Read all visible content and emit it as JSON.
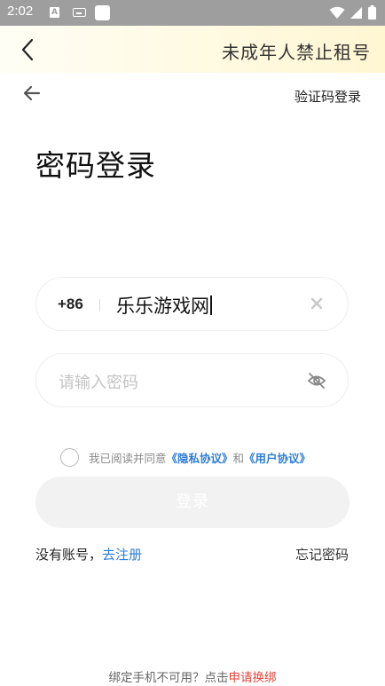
{
  "status_bar": {
    "time": "2:02",
    "notification_icons": [
      "a-icon",
      "keyboard-icon",
      "square-icon"
    ],
    "system_icons": [
      "wifi-icon",
      "signal-icon",
      "battery-icon"
    ]
  },
  "top_bar": {
    "title": "未成年人禁止租号"
  },
  "nav": {
    "switch_login_label": "验证码登录"
  },
  "page_title": "密码登录",
  "phone_field": {
    "prefix": "+86",
    "value": "乐乐游戏网"
  },
  "password_field": {
    "placeholder": "请输入密码"
  },
  "agreement": {
    "text_before": "我已阅读并同意",
    "privacy_link": "《隐私协议》",
    "conjunction": "和",
    "user_link": "《用户协议》",
    "checked": false
  },
  "login_button": {
    "label": "登录"
  },
  "register": {
    "prompt": "没有账号，",
    "link": "去注册"
  },
  "forgot_password": "忘记密码",
  "footer": {
    "text": "绑定手机不可用？点击",
    "link": "申请换绑"
  },
  "colors": {
    "accent_blue": "#2d7cd6",
    "footer_link_red": "#e2453c",
    "top_bar_gradient_end": "#fff6d2",
    "status_bar": "#9e9e9e"
  }
}
